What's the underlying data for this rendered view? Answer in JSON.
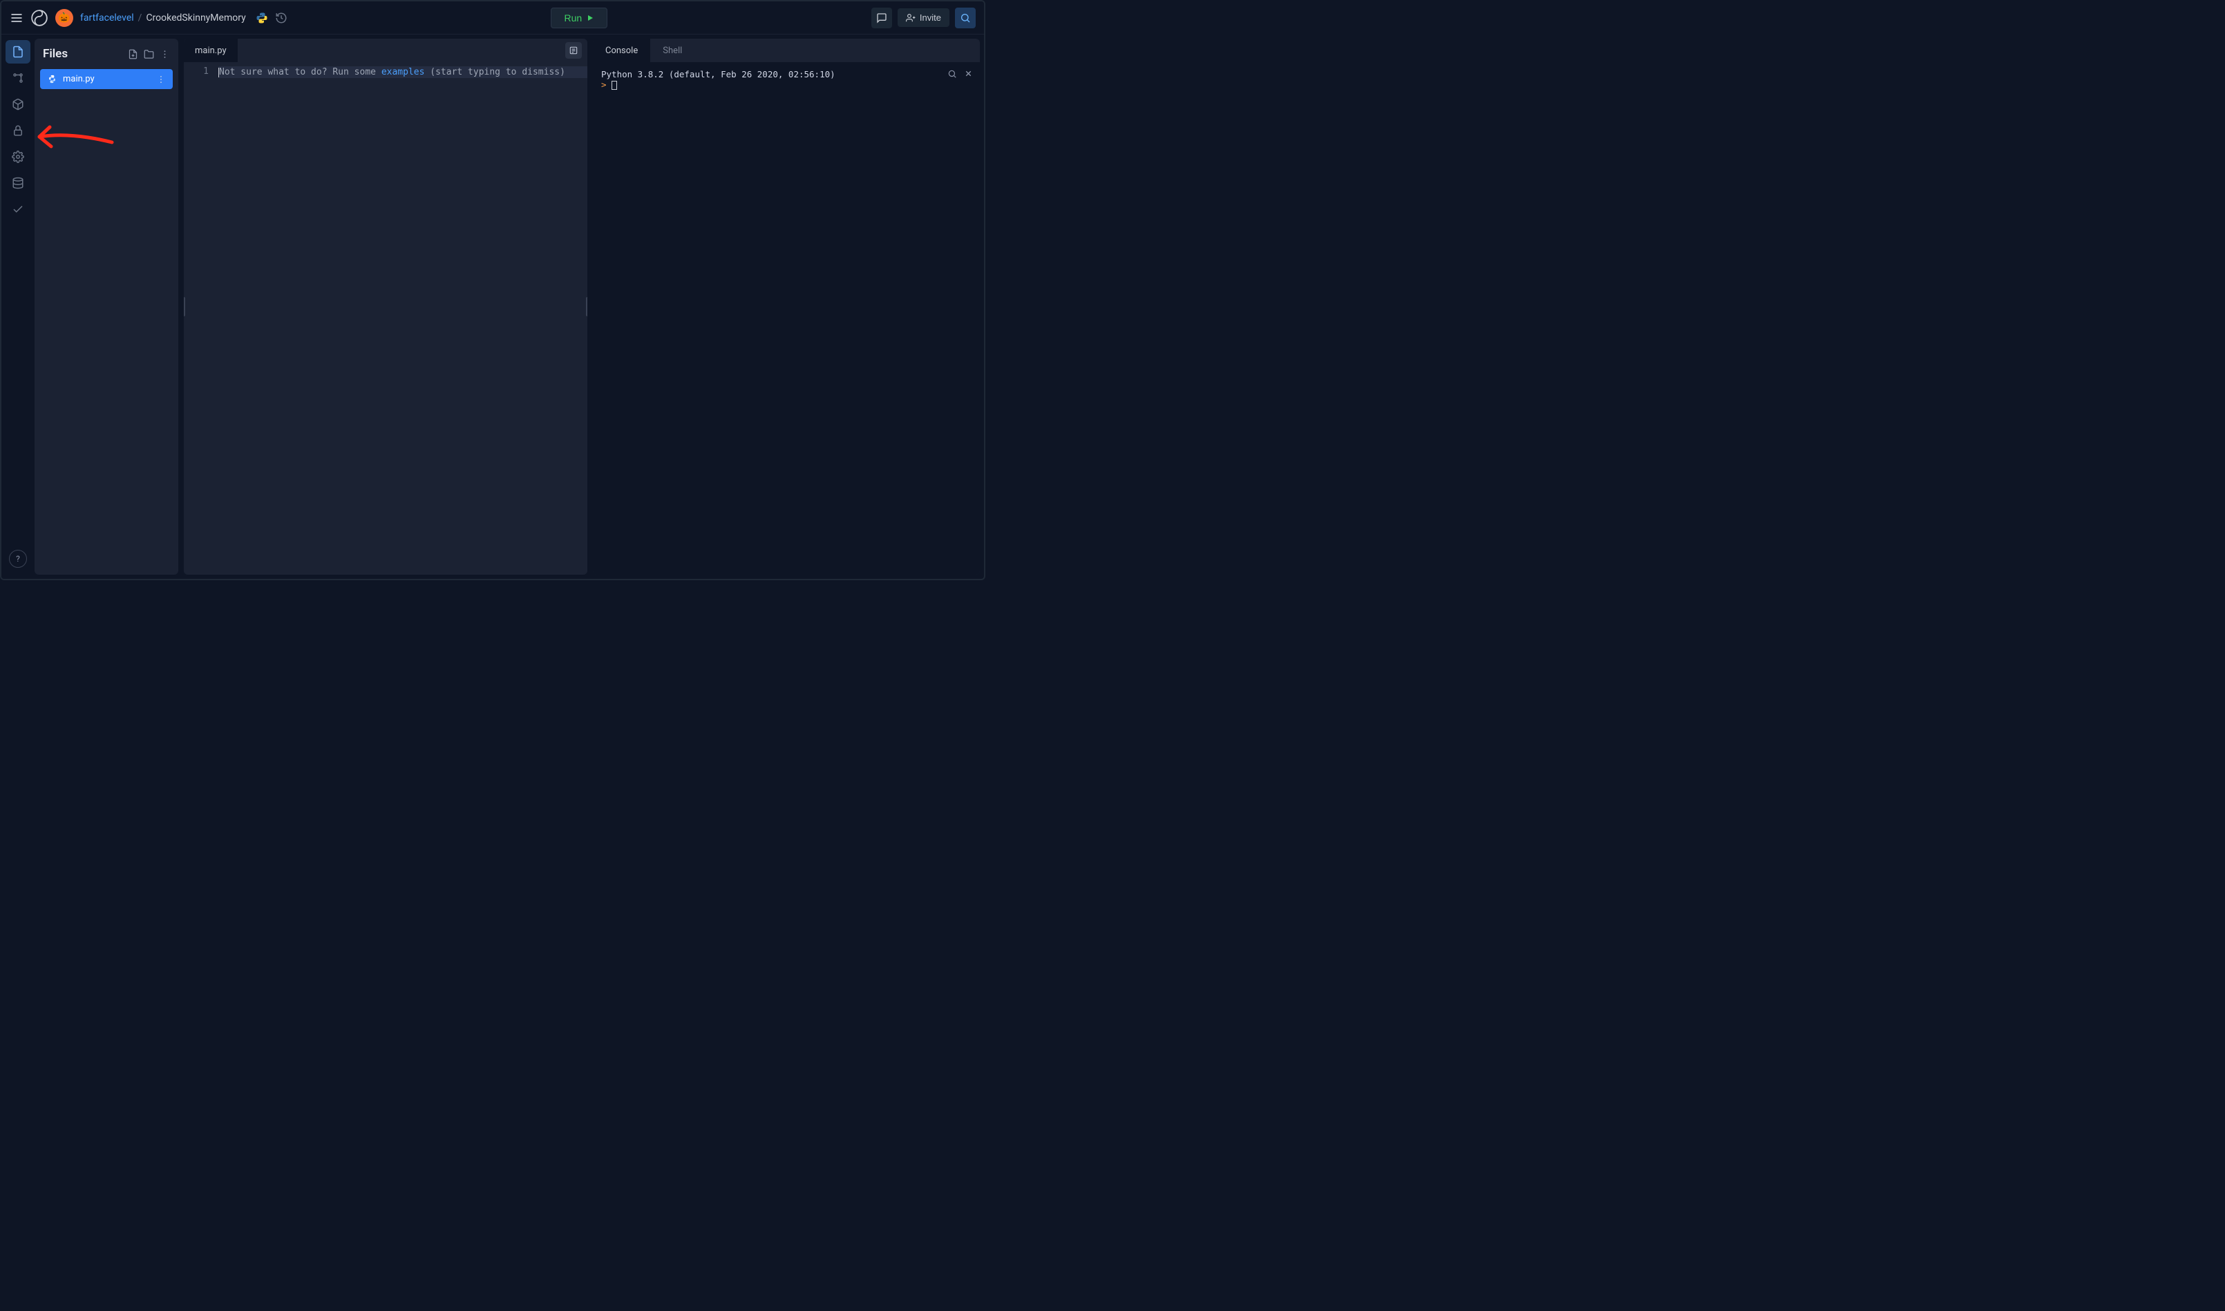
{
  "header": {
    "username": "fartfacelevel",
    "separator": "/",
    "repo": "CrookedSkinnyMemory",
    "run_label": "Run",
    "invite_label": "Invite"
  },
  "sidebar": {
    "title": "Files",
    "file": "main.py"
  },
  "editor": {
    "tab": "main.py",
    "line_number": "1",
    "line_prefix": "Not sure what to do? Run some ",
    "line_link": "examples",
    "line_suffix": " (start typing to dismiss)"
  },
  "right": {
    "tab_console": "Console",
    "tab_shell": "Shell",
    "console_line": "Python 3.8.2 (default, Feb 26 2020, 02:56:10)",
    "prompt_symbol": ">"
  },
  "help_label": "?"
}
